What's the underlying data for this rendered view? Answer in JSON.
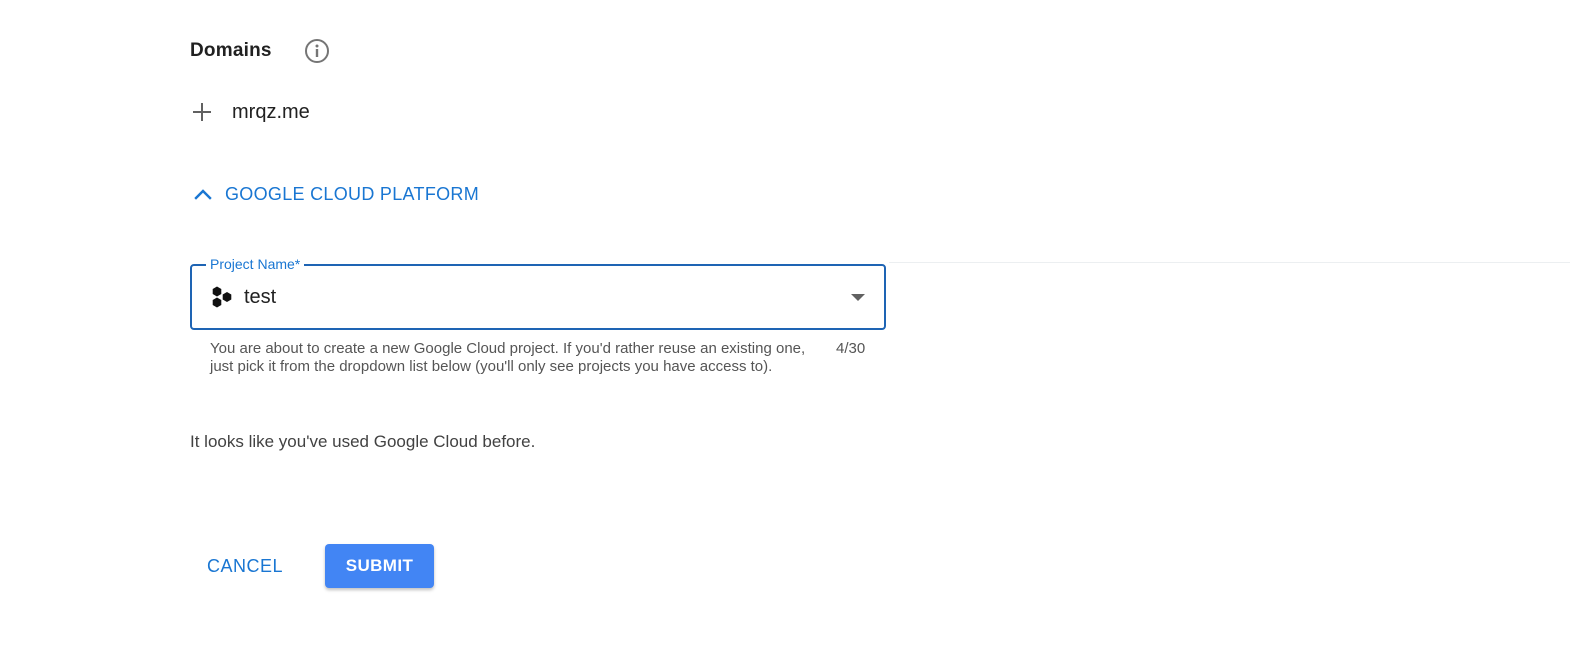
{
  "domains": {
    "title": "Domains",
    "info_icon": "info-icon",
    "add_icon": "plus-icon",
    "items": [
      {
        "name": "mrqz.me"
      }
    ]
  },
  "gcp": {
    "toggle_label": "GOOGLE CLOUD PLATFORM",
    "toggle_icon": "chevron-up-icon",
    "project_field": {
      "label": "Project Name*",
      "value": "test",
      "icon": "google-cloud-project-icon",
      "dropdown_icon": "dropdown-arrow-icon",
      "helper": "You are about to create a new Google Cloud project. If you'd rather reuse an existing one, just pick it from the dropdown list below (you'll only see projects you have access to).",
      "char_count": "4/30"
    },
    "notice": "It looks like you've used Google Cloud before."
  },
  "actions": {
    "cancel_label": "CANCEL",
    "submit_label": "SUBMIT"
  },
  "colors": {
    "accent": "#1976d2",
    "field_border": "#1e64b4",
    "submit_bg": "#4285f4",
    "text_primary": "#212121",
    "text_secondary": "#555555"
  }
}
